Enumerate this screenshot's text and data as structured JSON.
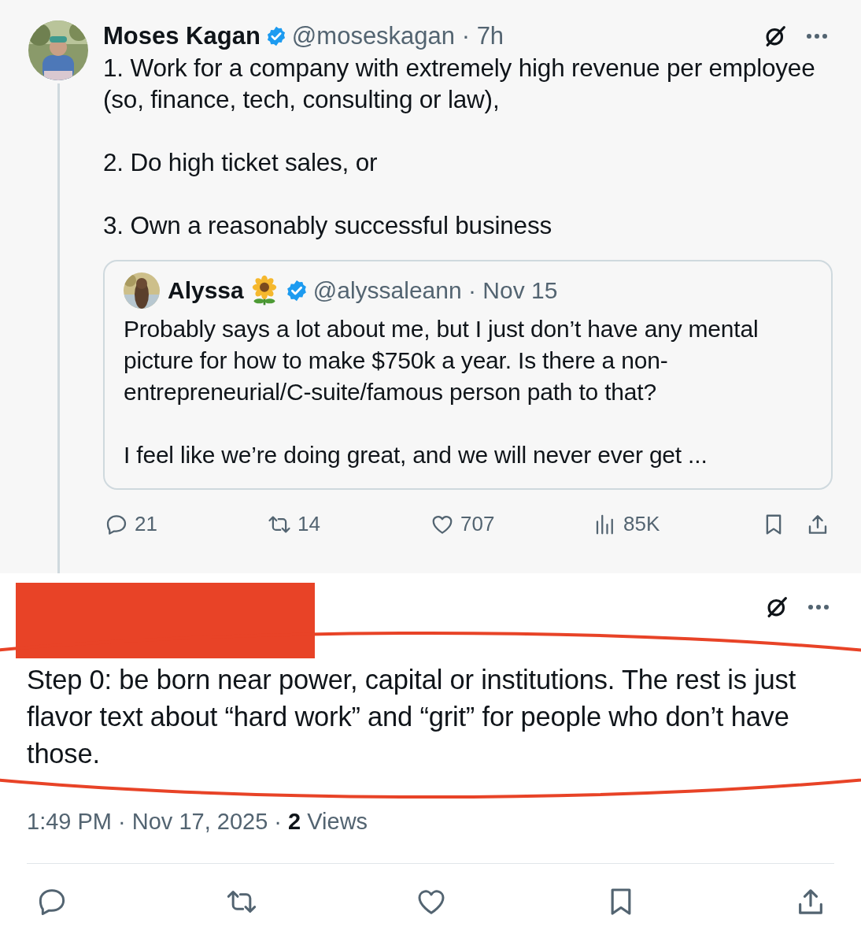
{
  "main_tweet": {
    "author": {
      "name": "Moses Kagan",
      "verified": true,
      "meta": "@moseskagan · 7h"
    },
    "paragraphs": [
      "1. Work for a company with extremely high revenue per employee (so, finance, tech, consulting or law),",
      "2. Do high ticket sales, or",
      "3. Own a reasonably successful business"
    ],
    "quoted_tweet": {
      "author": {
        "name": "Alyssa",
        "verified": true,
        "meta": "@alyssaleann · Nov 15"
      },
      "paragraphs": [
        "Probably says a lot about me, but I just don’t have any mental picture for how to make $750k a year. Is there a non-entrepreneurial/C-suite/famous person path to that?",
        "I feel like we’re doing great, and we will never ever get ..."
      ]
    },
    "actions": [
      {
        "kind": "reply",
        "count": "21"
      },
      {
        "kind": "repost",
        "count": "14"
      },
      {
        "kind": "like",
        "count": "707"
      },
      {
        "kind": "views",
        "count": "85K"
      },
      {
        "kind": "bookmark"
      },
      {
        "kind": "share"
      }
    ]
  },
  "reply_tweet": {
    "author_redacted": true,
    "circled": true,
    "text": "Step 0: be born near power, capital or institutions. The rest is just flavor text about “hard work” and “grit” for people who don’t have those.",
    "timestamp": "1:49 PM · Nov 17, 2025 · **2** Views",
    "actions": [
      {
        "kind": "reply"
      },
      {
        "kind": "repost"
      },
      {
        "kind": "like"
      },
      {
        "kind": "bookmark"
      },
      {
        "kind": "share"
      }
    ]
  }
}
